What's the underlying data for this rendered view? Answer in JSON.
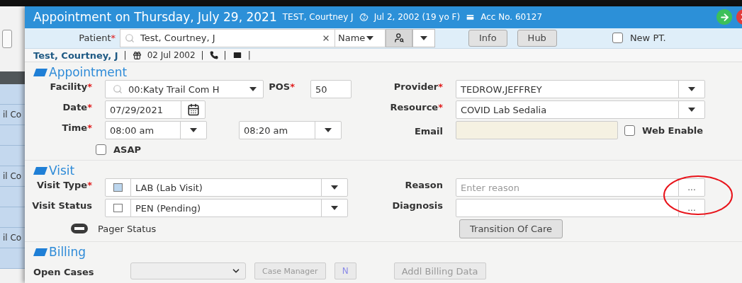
{
  "background": {
    "cells": [
      "il Co",
      "il Co",
      "il Co"
    ]
  },
  "dialog": {
    "title": "Appointment on Thursday, July 29, 2021",
    "patient": "TEST, Courtney J",
    "dob": "Jul 2, 2002 (19 yo F)",
    "account": "Acc No. 60127"
  },
  "required_mark": "*",
  "patient_bar": {
    "label": "Patient",
    "required": true,
    "value": "Test, Courtney, J",
    "search_by": "Name",
    "buttons": [
      "Info",
      "Hub"
    ],
    "new_pt": {
      "label": "New PT.",
      "checked": false
    }
  },
  "patient_info": [
    {
      "kind": "name",
      "text": "Test, Courtney, J"
    },
    {
      "kind": "separator",
      "text": "|"
    },
    {
      "kind": "birthday",
      "text": "02 Jul 2002"
    },
    {
      "kind": "separator",
      "text": "|"
    },
    {
      "kind": "phone"
    },
    {
      "kind": "separator",
      "text": "|"
    },
    {
      "kind": "email"
    },
    {
      "kind": "separator",
      "text": "|"
    }
  ],
  "appointment": {
    "title": "Appointment",
    "facility": {
      "label": "Facility",
      "required": true,
      "value": "00:Katy Trail Com H"
    },
    "pos": {
      "label": "POS",
      "required": true,
      "value": "50"
    },
    "date": {
      "label": "Date",
      "required": true,
      "value": "07/29/2021"
    },
    "time": {
      "label": "Time",
      "required": true,
      "start": "08:00 am",
      "end": "08:20 am"
    },
    "asap": {
      "label": "ASAP",
      "checked": false
    },
    "provider": {
      "label": "Provider",
      "required": true,
      "value": "TEDROW,JEFFREY"
    },
    "resource": {
      "label": "Resource",
      "required": true,
      "value": "COVID Lab Sedalia"
    },
    "email": {
      "label": "Email",
      "required": false
    },
    "web_enable": {
      "label": "Web Enable",
      "checked": false
    }
  },
  "visit": {
    "title": "Visit",
    "visit_type": {
      "label": "Visit Type",
      "required": true,
      "value": "LAB (Lab Visit)",
      "color": "#bcd6ee"
    },
    "visit_status": {
      "label": "Visit Status",
      "required": false,
      "value": "PEN (Pending)",
      "color": "#ffffff"
    },
    "pager_status": {
      "label": "Pager Status"
    },
    "reason": {
      "label": "Reason",
      "required": false,
      "placeholder": "Enter reason",
      "button": "..."
    },
    "diagnosis": {
      "label": "Diagnosis",
      "required": false,
      "button": "..."
    },
    "transition": "Transition Of Care"
  },
  "billing": {
    "title": "Billing",
    "open_cases": {
      "label": "Open Cases",
      "disabled": true
    },
    "case_manager": {
      "label": "Case Manager",
      "disabled": true
    },
    "n_button": {
      "label": "N",
      "disabled": true
    },
    "addl": {
      "label": "Addl Billing Data",
      "disabled": true
    }
  },
  "annotation": {
    "kind": "ellipse"
  }
}
